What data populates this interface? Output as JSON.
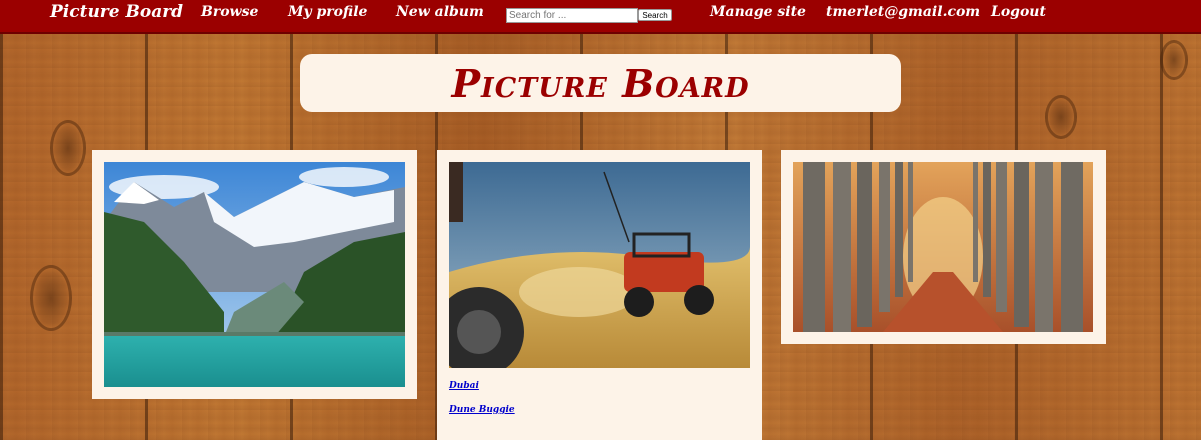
{
  "nav": {
    "brand": "Picture Board",
    "browse": "Browse",
    "my_profile": "My profile",
    "new_album": "New album",
    "manage_site": "Manage site",
    "user_email": "tmerlet@gmail.com",
    "logout": "Logout"
  },
  "search": {
    "placeholder": "Search for ...",
    "button_label": "Search"
  },
  "header": {
    "title": "Picture Board"
  },
  "cards": [
    {
      "image_icon": "mountain-lake-photo"
    },
    {
      "image_icon": "dune-buggy-photo",
      "links": [
        "Dubai",
        "Dune Buggie"
      ]
    },
    {
      "image_icon": "autumn-avenue-photo"
    }
  ],
  "colors": {
    "nav_background": "#9b0000",
    "title_text": "#9b0000",
    "card_background": "#fdf3e8",
    "link": "#0000cc"
  }
}
